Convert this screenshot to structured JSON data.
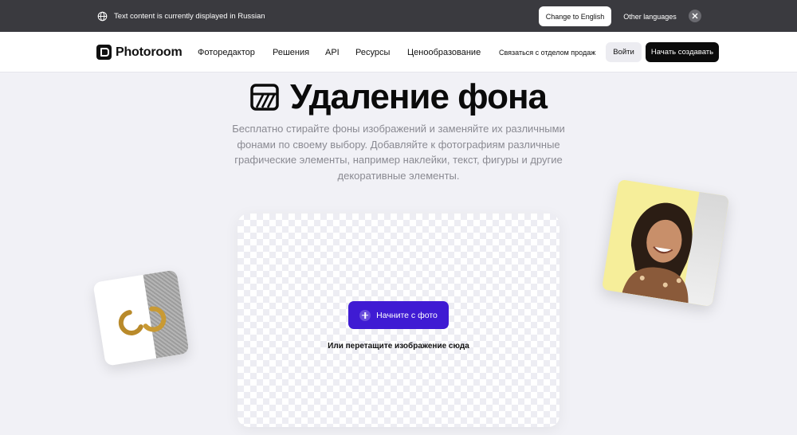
{
  "banner": {
    "message": "Text content is currently displayed in Russian",
    "change_label": "Change to English",
    "other_label": "Other languages"
  },
  "nav": {
    "logo_text": "Photoroom",
    "items": [
      "Фоторедактор",
      "Решения",
      "API",
      "Ресурсы",
      "Ценообразование"
    ],
    "contact_sales": "Связаться с отделом продаж",
    "login": "Войти",
    "start": "Начать создавать"
  },
  "hero": {
    "title": "Удаление фона",
    "description": "Бесплатно стирайте фоны изображений и заменяйте их различными фонами по своему выбору. Добавляйте к фотографиям различные графические элементы, например наклейки, текст, фигуры и другие декоративные элементы."
  },
  "upload": {
    "button_label": "Начните с фото",
    "hint": "Или перетащите изображение сюда"
  },
  "colors": {
    "accent": "#3f1bd3",
    "banner_bg": "#3a3a3f",
    "page_bg": "#f1f1f6"
  },
  "icons": [
    "globe-icon",
    "close-icon",
    "photoroom-logo-icon",
    "background-remove-icon",
    "plus-icon"
  ]
}
